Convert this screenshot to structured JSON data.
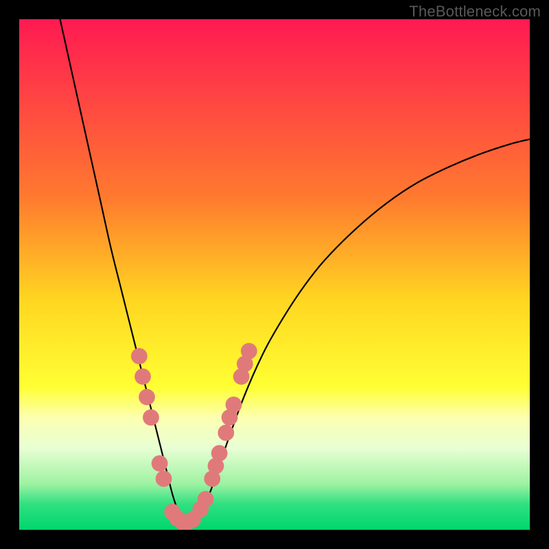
{
  "watermark": "TheBottleneck.com",
  "chart_data": {
    "type": "line",
    "title": "",
    "xlabel": "",
    "ylabel": "",
    "xlim": [
      0,
      100
    ],
    "ylim": [
      0,
      100
    ],
    "gradient_stops": [
      {
        "offset": 0,
        "color": "#ff1a52"
      },
      {
        "offset": 35,
        "color": "#ff7a2f"
      },
      {
        "offset": 55,
        "color": "#ffd621"
      },
      {
        "offset": 72,
        "color": "#ffff33"
      },
      {
        "offset": 78,
        "color": "#fcffb0"
      },
      {
        "offset": 84,
        "color": "#e8ffd4"
      },
      {
        "offset": 91,
        "color": "#9ef2a2"
      },
      {
        "offset": 95,
        "color": "#2fe081"
      },
      {
        "offset": 100,
        "color": "#00d66c"
      }
    ],
    "series": [
      {
        "name": "curve",
        "x": [
          8,
          10,
          12,
          14,
          16,
          18,
          20,
          22,
          24,
          26,
          28,
          29,
          30,
          31,
          32,
          33,
          34,
          35,
          36,
          38,
          40,
          44,
          48,
          52,
          56,
          60,
          66,
          72,
          78,
          84,
          90,
          96,
          100
        ],
        "y": [
          100,
          91,
          82,
          73,
          64,
          55,
          47,
          39,
          31,
          23,
          15,
          11,
          7,
          4,
          2,
          1,
          1,
          2,
          4,
          9,
          15,
          26,
          35,
          42,
          48,
          53,
          59,
          64,
          68,
          71,
          73.5,
          75.5,
          76.5
        ]
      }
    ],
    "markers": {
      "color": "#e07a7a",
      "radius_pct": 1.6,
      "points_xy": [
        [
          23.5,
          34
        ],
        [
          24.2,
          30
        ],
        [
          25.0,
          26
        ],
        [
          25.8,
          22
        ],
        [
          27.5,
          13
        ],
        [
          28.3,
          10
        ],
        [
          30.0,
          3.5
        ],
        [
          31.0,
          2.2
        ],
        [
          32.0,
          1.5
        ],
        [
          33.0,
          1.5
        ],
        [
          34.0,
          2.0
        ],
        [
          35.5,
          4.0
        ],
        [
          36.5,
          6.0
        ],
        [
          37.8,
          10.0
        ],
        [
          38.5,
          12.5
        ],
        [
          39.2,
          15.0
        ],
        [
          40.5,
          19.0
        ],
        [
          41.2,
          22.0
        ],
        [
          42.0,
          24.5
        ],
        [
          43.5,
          30.0
        ],
        [
          44.2,
          32.5
        ],
        [
          45.0,
          35.0
        ]
      ]
    }
  }
}
